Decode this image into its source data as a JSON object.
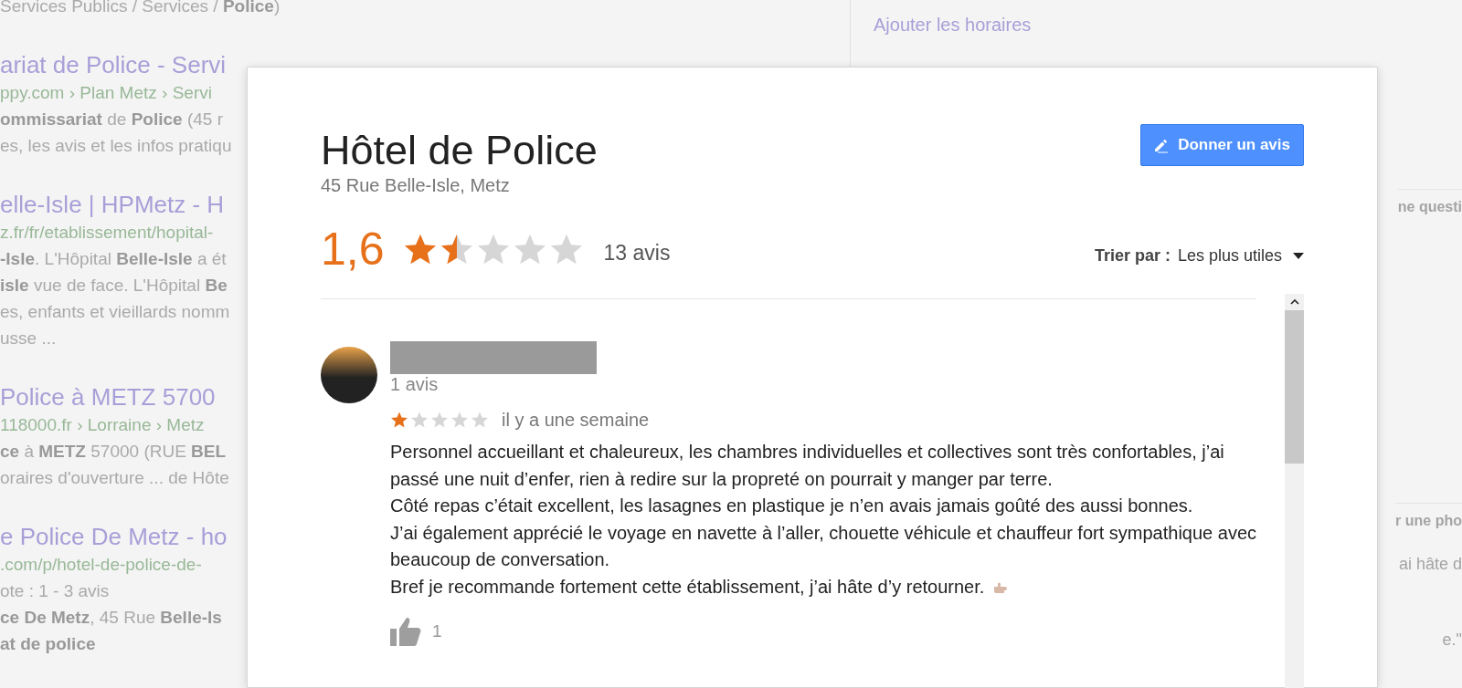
{
  "background": {
    "results": [
      {
        "kind": "snippet",
        "text": "Services Publics / Services / **Police**)"
      },
      {
        "kind": "title",
        "text": "ariat de Police - Servi"
      },
      {
        "kind": "url",
        "text": "ppy.com › Plan Metz › Servi"
      },
      {
        "kind": "snippet",
        "text": "**ommissariat** de **Police** (45 r"
      },
      {
        "kind": "snippet",
        "text": "es, les avis et les infos pratiqu"
      },
      {
        "kind": "title",
        "text": "elle-Isle | HPMetz - H"
      },
      {
        "kind": "url",
        "text": "z.fr/fr/etablissement/hopital-"
      },
      {
        "kind": "snippet",
        "text": "**-Isle**. L'Hôpital **Belle-Isle** a ét"
      },
      {
        "kind": "snippet",
        "text": "**isle** vue de face. L'Hôpital **Be**"
      },
      {
        "kind": "snippet",
        "text": "es, enfants et vieillards nomm"
      },
      {
        "kind": "snippet",
        "text": "usse ..."
      },
      {
        "kind": "title",
        "text": "Police à METZ 5700"
      },
      {
        "kind": "url",
        "text": "118000.fr › Lorraine › Metz"
      },
      {
        "kind": "snippet",
        "text": "**ce** à **METZ** 57000 (RUE **BEL**"
      },
      {
        "kind": "snippet",
        "text": "oraires d'ouverture ... de Hôte"
      },
      {
        "kind": "title",
        "text": "e Police De Metz - ho"
      },
      {
        "kind": "url",
        "text": ".com/p/hotel-de-police-de-"
      },
      {
        "kind": "snippet",
        "text": "ote : 1 - 3 avis"
      },
      {
        "kind": "snippet",
        "text": "**ce De Metz**, 45 Rue **Belle-Is**"
      },
      {
        "kind": "snippet",
        "text": "**at de police**"
      }
    ],
    "side": {
      "link": "Ajouter les horaires",
      "question_button": "ne questi",
      "photo_button": "r une pho",
      "quote": "ai hâte d",
      "quote_end": "e.\""
    }
  },
  "dialog": {
    "title": "Hôtel de Police",
    "address": "45 Rue Belle-Isle, Metz",
    "review_button": "Donner un avis",
    "rating": {
      "score": "1,6",
      "stars": 1.5,
      "count": "13 avis"
    },
    "sort": {
      "label": "Trier par :",
      "value": "Les plus utiles"
    },
    "reviews": [
      {
        "reviewer_reviews": "1 avis",
        "stars": 1,
        "time": "il y a une semaine",
        "paragraphs": [
          "Personnel accueillant et chaleureux, les chambres individuelles et collectives sont très confortables, j’ai passé une nuit d’enfer, rien à redire sur la propreté on pourrait y manger par terre.",
          "Côté repas c’était excellent, les lasagnes en plastique je n’en avais jamais goûté des aussi bonnes.",
          "J’ai également apprécié le voyage en navette à  l’aller, chouette véhicule et chauffeur fort sympathique avec beaucoup de conversation.",
          "Bref je recommande fortement cette établissement, j’ai hâte d’y retourner."
        ],
        "likes": "1"
      }
    ]
  }
}
